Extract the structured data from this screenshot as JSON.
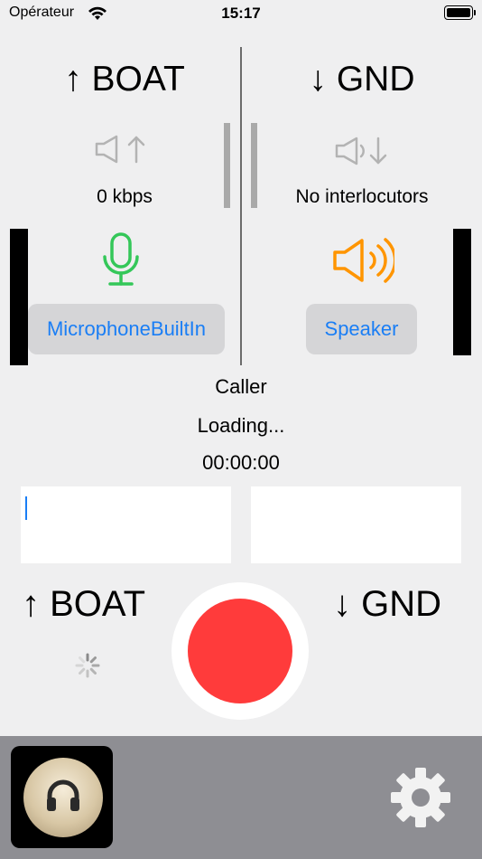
{
  "status": {
    "carrier": "Opérateur",
    "time": "15:17"
  },
  "boat": {
    "title": "↑ BOAT",
    "bitrate": "0 kbps",
    "input_button": "MicrophoneBuiltIn"
  },
  "gnd": {
    "title": "↓ GND",
    "status": "No interlocutors",
    "output_button": "Speaker"
  },
  "call": {
    "role": "Caller",
    "state": "Loading...",
    "duration": "00:00:00"
  },
  "bottom": {
    "boat_label": "↑ BOAT",
    "gnd_label": "↓ GND"
  },
  "colors": {
    "microphone": "#34c759",
    "speaker": "#ff9500",
    "record": "#ff3b3b",
    "link": "#1a7ef5"
  }
}
